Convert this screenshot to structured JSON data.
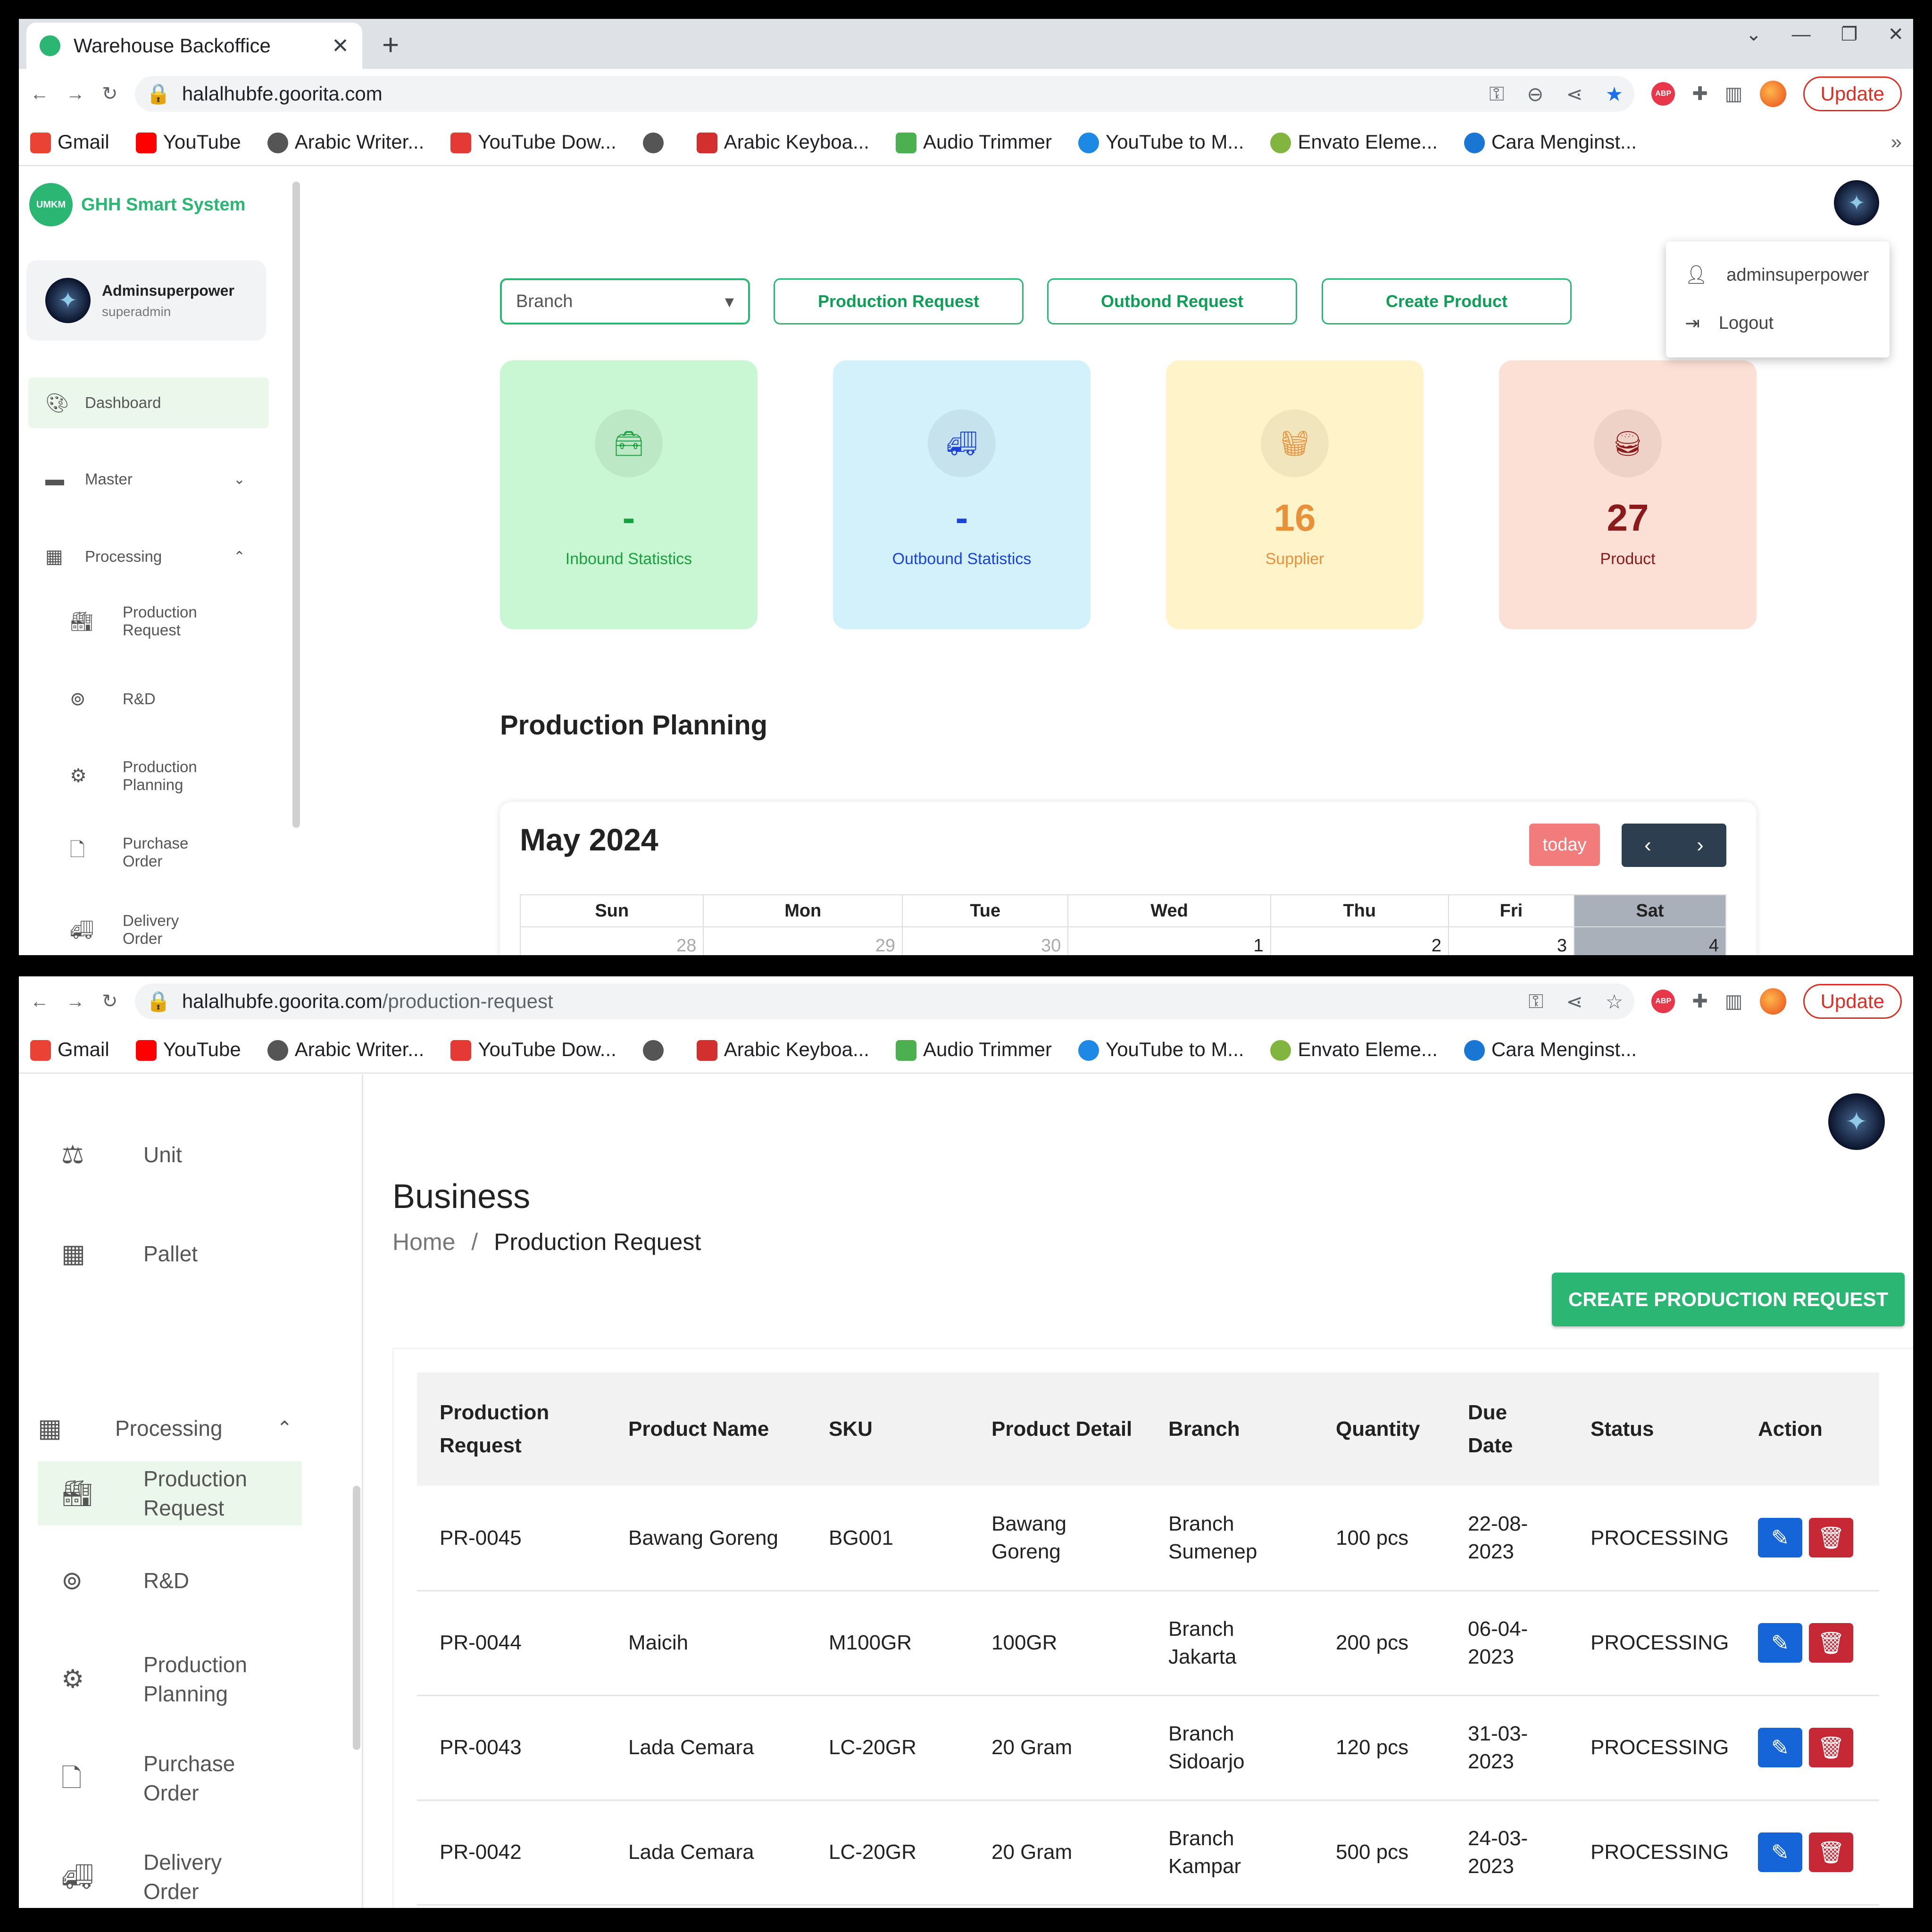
{
  "s1": {
    "tab_title": "Warehouse Backoffice",
    "url": "halalhubfe.goorita.com",
    "update": "Update",
    "bookmarks": [
      "Gmail",
      "YouTube",
      "Arabic Writer...",
      "YouTube Dow...",
      "",
      "Arabic Keyboa...",
      "Audio Trimmer",
      "YouTube to M...",
      "Envato Eleme...",
      "Cara Menginst..."
    ],
    "logo_mark": "UMKM",
    "brand": "GHH Smart System",
    "user_name": "Adminsuperpower",
    "user_role": "superadmin",
    "nav": {
      "dashboard": "Dashboard",
      "master": "Master",
      "processing": "Processing",
      "pr": "Production Request",
      "rnd": "R&D",
      "pp": "Production Planning",
      "po": "Purchase Order",
      "do": "Delivery Order"
    },
    "branch_placeholder": "Branch",
    "btn_pr": "Production Request",
    "btn_outbound": "Outbond Request",
    "btn_create": "Create Product",
    "menu_user": "adminsuperpower",
    "menu_logout": "Logout",
    "cards": [
      {
        "value": "-",
        "label": "Inbound Statistics",
        "bg": "#c9f7d3",
        "color": "#1a9e3e",
        "icon": "toolbox-icon"
      },
      {
        "value": "-",
        "label": "Outbound Statistics",
        "bg": "#d3f1fb",
        "color": "#1c44d8",
        "icon": "truck-icon"
      },
      {
        "value": "16",
        "label": "Supplier",
        "bg": "#fff4c9",
        "color": "#e8903a",
        "icon": "basket-icon"
      },
      {
        "value": "27",
        "label": "Product",
        "bg": "#fde0d5",
        "color": "#8b1a1a",
        "icon": "fastfood-icon"
      }
    ],
    "section": "Production Planning",
    "month": "May 2024",
    "today": "today",
    "days": [
      "Sun",
      "Mon",
      "Tue",
      "Wed",
      "Thu",
      "Fri",
      "Sat"
    ],
    "week1": [
      "28",
      "29",
      "30",
      "1",
      "2",
      "3",
      "4"
    ]
  },
  "s2": {
    "url_host": "halalhubfe.goorita.com",
    "url_path": "/production-request",
    "update": "Update",
    "bookmarks": [
      "Gmail",
      "YouTube",
      "Arabic Writer...",
      "YouTube Dow...",
      "",
      "Arabic Keyboa...",
      "Audio Trimmer",
      "YouTube to M...",
      "Envato Eleme...",
      "Cara Menginst..."
    ],
    "nav": {
      "unit": "Unit",
      "pallet": "Pallet",
      "processing": "Processing",
      "pr1": "Production",
      "pr2": "Request",
      "rnd": "R&D",
      "pp1": "Production",
      "pp2": "Planning",
      "po1": "Purchase",
      "po2": "Order",
      "do1": "Delivery",
      "do2": "Order"
    },
    "title": "Business",
    "crumb_home": "Home",
    "crumb_sep": "/",
    "crumb_cur": "Production Request",
    "create_btn": "CREATE PRODUCTION REQUEST",
    "headers": [
      [
        "Production",
        "Request"
      ],
      [
        "Product Name"
      ],
      [
        "SKU"
      ],
      [
        "Product Detail"
      ],
      [
        "Branch"
      ],
      [
        "Quantity"
      ],
      [
        "Due",
        "Date"
      ],
      [
        "Status"
      ],
      [
        "Action"
      ]
    ],
    "rows": [
      {
        "id": "PR-0045",
        "name": "Bawang Goreng",
        "sku": "BG001",
        "detail": [
          "Bawang",
          "Goreng"
        ],
        "branch": [
          "Branch",
          "Sumenep"
        ],
        "qty": "100 pcs",
        "due": [
          "22-08-",
          "2023"
        ],
        "status": "PROCESSING"
      },
      {
        "id": "PR-0044",
        "name": "Maicih",
        "sku": "M100GR",
        "detail": [
          "100GR"
        ],
        "branch": [
          "Branch",
          "Jakarta"
        ],
        "qty": "200 pcs",
        "due": [
          "06-04-",
          "2023"
        ],
        "status": "PROCESSING"
      },
      {
        "id": "PR-0043",
        "name": "Lada Cemara",
        "sku": "LC-20GR",
        "detail": [
          "20 Gram"
        ],
        "branch": [
          "Branch",
          "Sidoarjo"
        ],
        "qty": "120 pcs",
        "due": [
          "31-03-",
          "2023"
        ],
        "status": "PROCESSING"
      },
      {
        "id": "PR-0042",
        "name": "Lada Cemara",
        "sku": "LC-20GR",
        "detail": [
          "20 Gram"
        ],
        "branch": [
          "Branch",
          "Kampar"
        ],
        "qty": "500 pcs",
        "due": [
          "24-03-",
          "2023"
        ],
        "status": "PROCESSING"
      }
    ]
  }
}
